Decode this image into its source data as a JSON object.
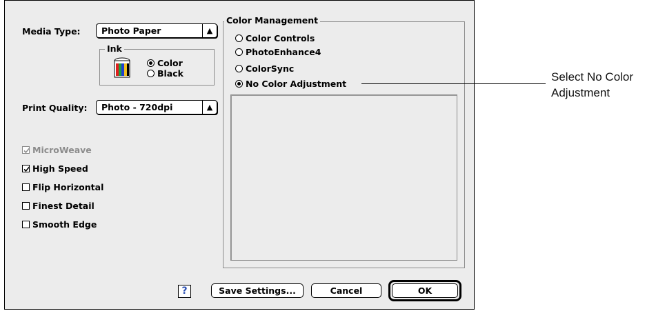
{
  "dialog": {
    "media_type": {
      "label": "Media Type:",
      "value": "Photo Paper"
    },
    "ink": {
      "title": "Ink",
      "options": [
        "Color",
        "Black"
      ],
      "selected": "Color"
    },
    "print_quality": {
      "label": "Print Quality:",
      "value": "Photo - 720dpi"
    },
    "checkboxes": {
      "microweave": {
        "label": "MicroWeave",
        "checked": true,
        "enabled": false
      },
      "high_speed": {
        "label": "High Speed",
        "checked": true
      },
      "flip_horizontal": {
        "label": "Flip Horizontal",
        "checked": false
      },
      "finest_detail": {
        "label": "Finest Detail",
        "checked": false
      },
      "smooth_edge": {
        "label": "Smooth Edge",
        "checked": false
      }
    },
    "color_management": {
      "title": "Color Management",
      "options": [
        "Color Controls",
        "PhotoEnhance4",
        "ColorSync",
        "No Color Adjustment"
      ],
      "selected": "No Color Adjustment"
    },
    "buttons": {
      "help": "?",
      "save": "Save Settings...",
      "cancel": "Cancel",
      "ok": "OK"
    }
  },
  "callout": {
    "line1": "Select No Color",
    "line2": "Adjustment"
  },
  "icons": {
    "ink_cartridge": "ink-cartridge-icon",
    "help": "help-icon",
    "popup_arrows": "updown-arrows-icon"
  }
}
